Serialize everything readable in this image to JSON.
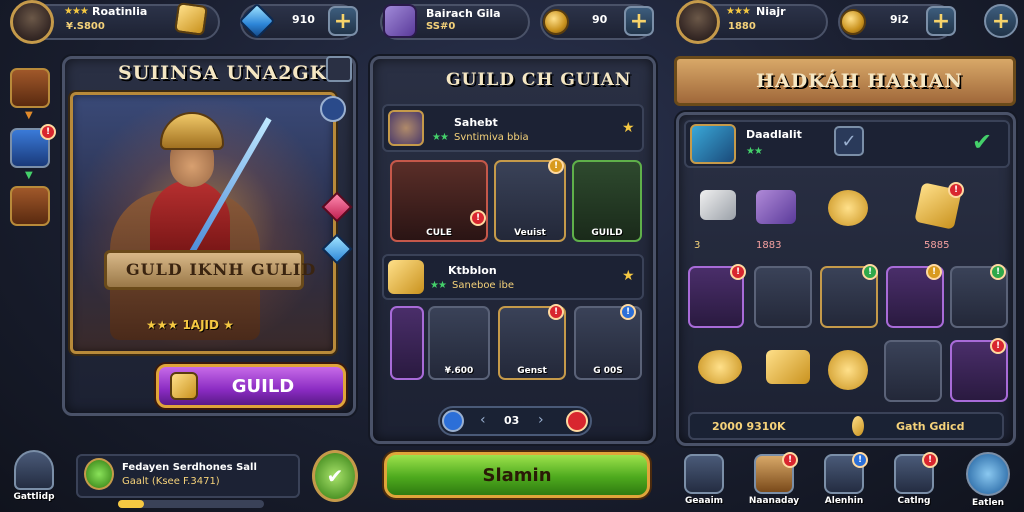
{
  "player": {
    "stars": "★★★",
    "name": "Roatinlia",
    "gold": "¥.S800"
  },
  "currencies": {
    "gems": "910",
    "guild_name": "Bairach Gila",
    "guild_sub": "SS#0",
    "coins": "90"
  },
  "player2": {
    "stars": "★★★",
    "name": "Niajr",
    "sub": "1880",
    "coins": "9i2"
  },
  "hero_panel": {
    "title": "SUIINSA UNA2GK",
    "banner": "GULD IKNH GULID",
    "rank": "★★★ 1AJID ★",
    "button": "GUILD"
  },
  "guild_panel": {
    "title": "GUILD CH GUIAN",
    "member1": {
      "name": "Sahebt",
      "sub": "Svntimiva bbia",
      "stars": "★★"
    },
    "row1": [
      "CULE",
      "Veuist",
      "GUILD"
    ],
    "member2": {
      "name": "Ktbblon",
      "sub": "Saneboe ibe",
      "stars": "★★"
    },
    "row2": [
      "",
      "¥.600",
      "Genst",
      "G 00S"
    ],
    "pager": "03",
    "start": "Slamin"
  },
  "daily_panel": {
    "title": "HADKÁH HARIAN",
    "featured": {
      "name": "Daadlalit",
      "stars": "★★"
    },
    "row1_labels": [
      "3",
      "1883",
      "",
      "5885"
    ],
    "footer_left": "2000 9310K",
    "footer_right": "Gath Gdicd"
  },
  "bottom": {
    "nav_left": "Gattlidp",
    "quest_title": "Fedayen Serdhones Sall",
    "quest_sub": "Gaalt (Ksee F.3471)",
    "nav_items": [
      "Geaaim",
      "Naanaday",
      "Alenhin",
      "Catlng",
      "Eatlen"
    ]
  },
  "colors": {
    "gold": "#c59a4a",
    "accent_green": "#4eaa1e",
    "accent_purple": "#8a2bc2",
    "panel": "#1c2132"
  }
}
